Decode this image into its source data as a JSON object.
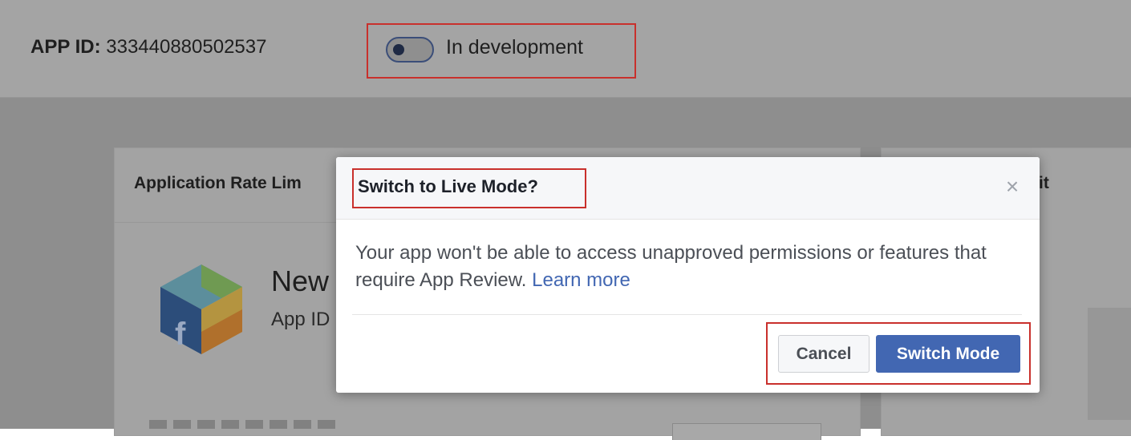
{
  "header": {
    "app_id_label": "APP ID:",
    "app_id_value": "333440880502537",
    "mode_label": "In development"
  },
  "background": {
    "card_title": "Application Rate Lim",
    "card2_title": "it",
    "app_name": "New",
    "app_id_label": "App ID"
  },
  "modal": {
    "title": "Switch to Live Mode?",
    "close_glyph": "×",
    "body_text": "Your app won't be able to access unapproved permissions or features that require App Review. ",
    "learn_more": "Learn more",
    "cancel_label": "Cancel",
    "switch_label": "Switch Mode"
  },
  "colors": {
    "primary": "#4267b2",
    "highlight": "#c9302c",
    "overlay": "#8e8e8e"
  }
}
